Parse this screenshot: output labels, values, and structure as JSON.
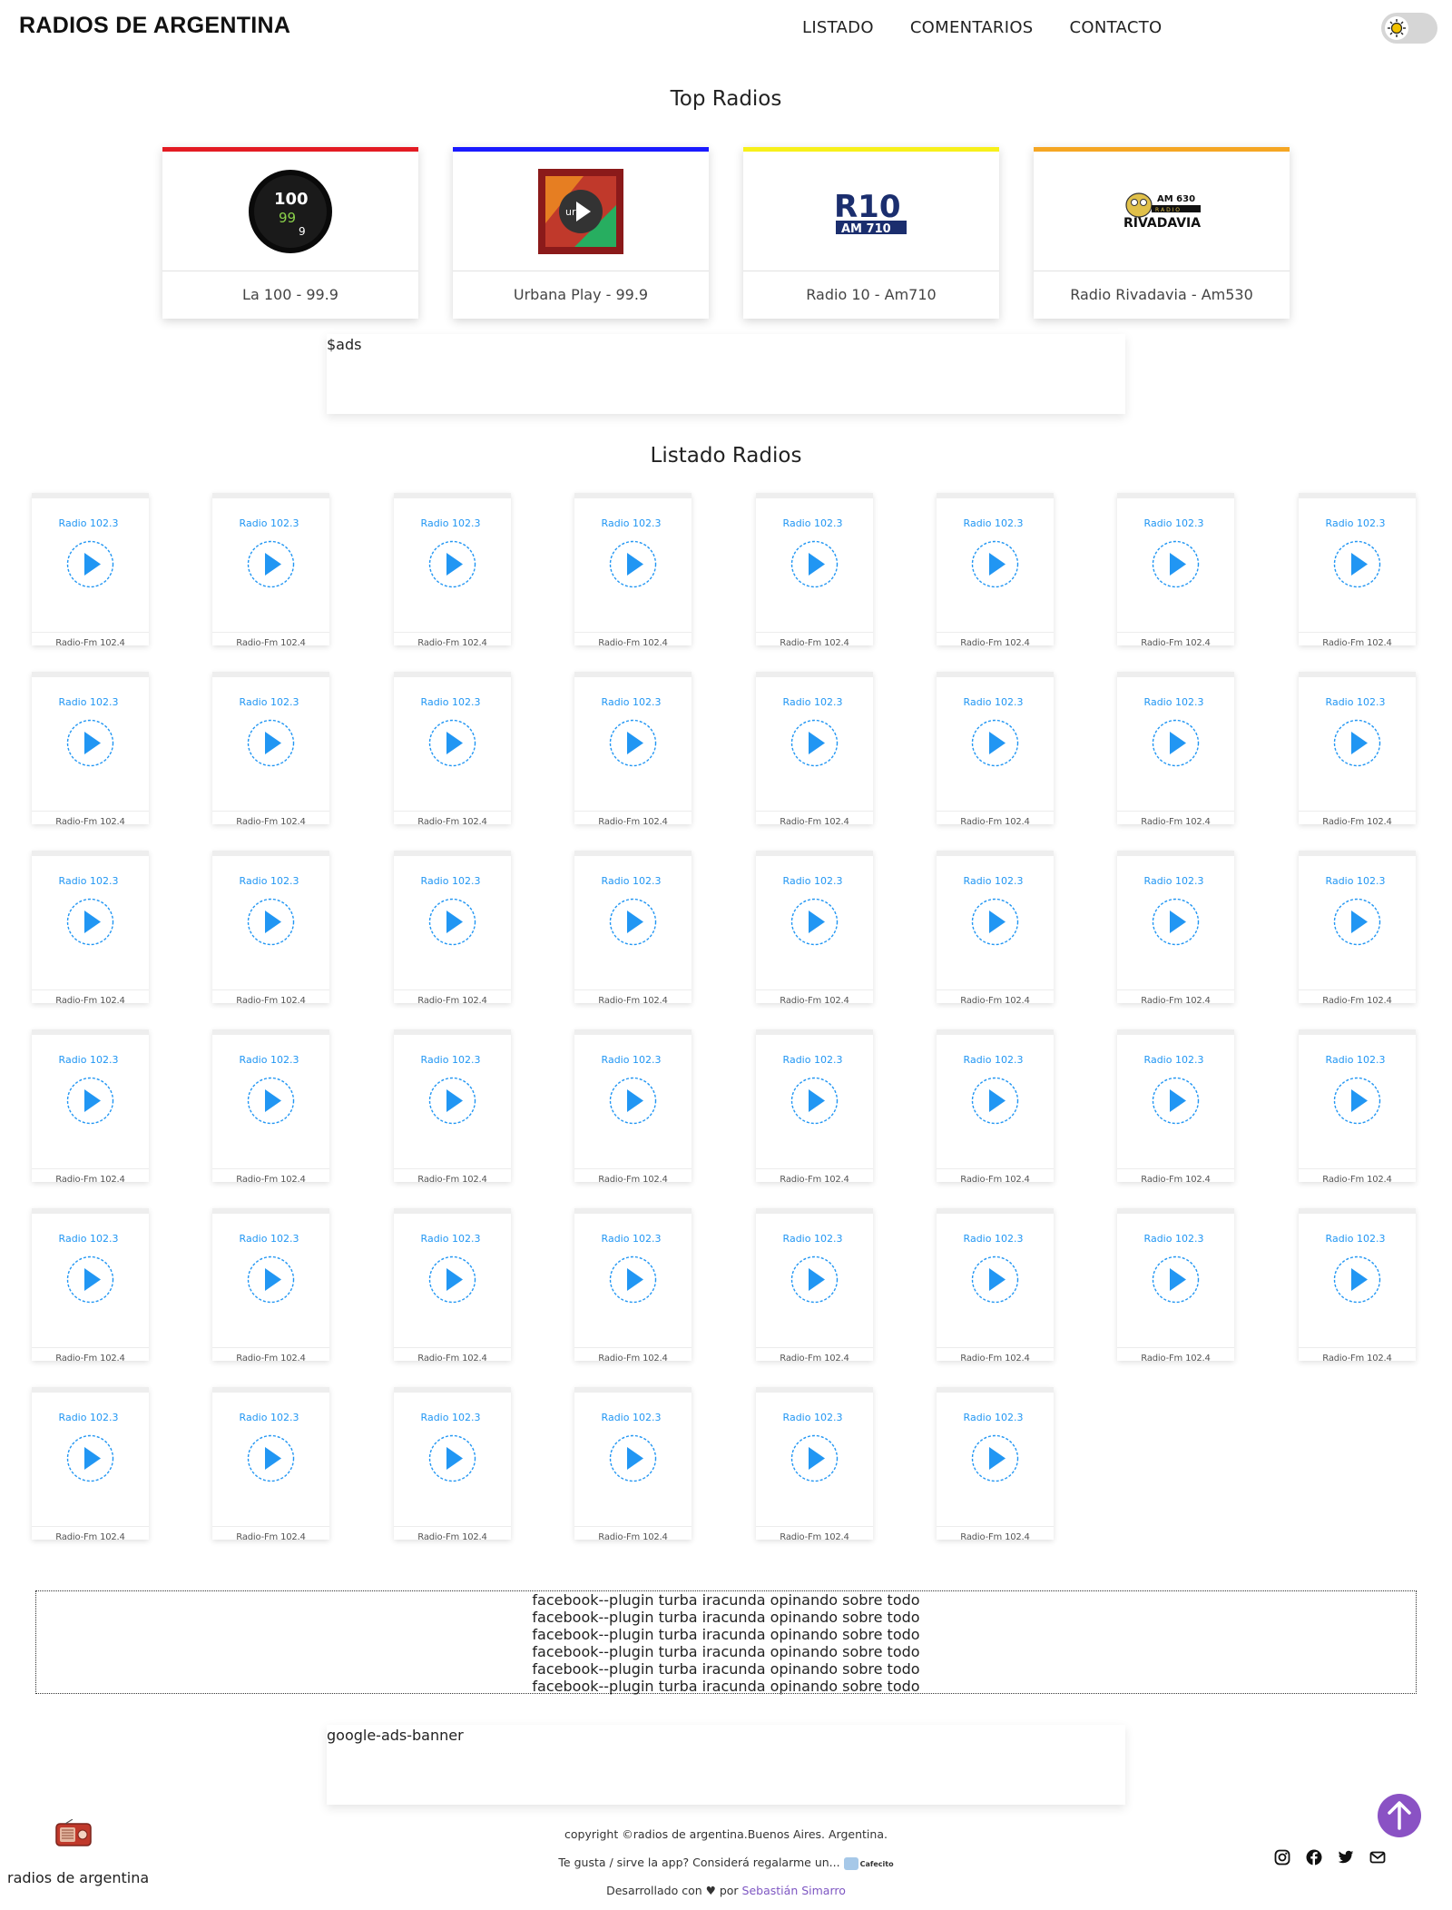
{
  "header": {
    "brand": "RADIOS DE ARGENTINA",
    "nav": [
      "LISTADO",
      "COMENTARIOS",
      "CONTACTO"
    ],
    "theme_toggle_icon": "sun-icon"
  },
  "top_section": {
    "title": "Top Radios",
    "cards": [
      {
        "name": "La 100 - 99.9",
        "accent": "#e31b23",
        "logo_icon": "la100-logo"
      },
      {
        "name": "Urbana Play - 99.9",
        "accent": "#1a1aff",
        "logo_icon": "urbana-play-logo"
      },
      {
        "name": "Radio 10 - Am710",
        "accent": "#f7f01a",
        "logo_icon": "radio10-logo"
      },
      {
        "name": "Radio Rivadavia - Am530",
        "accent": "#f5a623",
        "logo_icon": "rivadavia-logo"
      }
    ],
    "logo_text": {
      "la100_a": "100",
      "la100_b": "99",
      "la100_c": "9",
      "urbana": "urb",
      "radio10_top": "R10",
      "radio10_bottom": "AM 710",
      "riv_am": "AM 630",
      "riv_radio": "R A D I O",
      "riv_name": "RIVADAVIA"
    }
  },
  "ads_top": "$ads",
  "list_section": {
    "title": "Listado Radios",
    "play_icon": "play-circle-icon",
    "cards": [
      {
        "title": "Radio 102.3",
        "footer": "Radio-Fm 102.4"
      },
      {
        "title": "Radio 102.3",
        "footer": "Radio-Fm 102.4"
      },
      {
        "title": "Radio 102.3",
        "footer": "Radio-Fm 102.4"
      },
      {
        "title": "Radio 102.3",
        "footer": "Radio-Fm 102.4"
      },
      {
        "title": "Radio 102.3",
        "footer": "Radio-Fm 102.4"
      },
      {
        "title": "Radio 102.3",
        "footer": "Radio-Fm 102.4"
      },
      {
        "title": "Radio 102.3",
        "footer": "Radio-Fm 102.4"
      },
      {
        "title": "Radio 102.3",
        "footer": "Radio-Fm 102.4"
      },
      {
        "title": "Radio 102.3",
        "footer": "Radio-Fm 102.4"
      },
      {
        "title": "Radio 102.3",
        "footer": "Radio-Fm 102.4"
      },
      {
        "title": "Radio 102.3",
        "footer": "Radio-Fm 102.4"
      },
      {
        "title": "Radio 102.3",
        "footer": "Radio-Fm 102.4"
      },
      {
        "title": "Radio 102.3",
        "footer": "Radio-Fm 102.4"
      },
      {
        "title": "Radio 102.3",
        "footer": "Radio-Fm 102.4"
      },
      {
        "title": "Radio 102.3",
        "footer": "Radio-Fm 102.4"
      },
      {
        "title": "Radio 102.3",
        "footer": "Radio-Fm 102.4"
      },
      {
        "title": "Radio 102.3",
        "footer": "Radio-Fm 102.4"
      },
      {
        "title": "Radio 102.3",
        "footer": "Radio-Fm 102.4"
      },
      {
        "title": "Radio 102.3",
        "footer": "Radio-Fm 102.4"
      },
      {
        "title": "Radio 102.3",
        "footer": "Radio-Fm 102.4"
      },
      {
        "title": "Radio 102.3",
        "footer": "Radio-Fm 102.4"
      },
      {
        "title": "Radio 102.3",
        "footer": "Radio-Fm 102.4"
      },
      {
        "title": "Radio 102.3",
        "footer": "Radio-Fm 102.4"
      },
      {
        "title": "Radio 102.3",
        "footer": "Radio-Fm 102.4"
      },
      {
        "title": "Radio 102.3",
        "footer": "Radio-Fm 102.4"
      },
      {
        "title": "Radio 102.3",
        "footer": "Radio-Fm 102.4"
      },
      {
        "title": "Radio 102.3",
        "footer": "Radio-Fm 102.4"
      },
      {
        "title": "Radio 102.3",
        "footer": "Radio-Fm 102.4"
      },
      {
        "title": "Radio 102.3",
        "footer": "Radio-Fm 102.4"
      },
      {
        "title": "Radio 102.3",
        "footer": "Radio-Fm 102.4"
      },
      {
        "title": "Radio 102.3",
        "footer": "Radio-Fm 102.4"
      },
      {
        "title": "Radio 102.3",
        "footer": "Radio-Fm 102.4"
      },
      {
        "title": "Radio 102.3",
        "footer": "Radio-Fm 102.4"
      },
      {
        "title": "Radio 102.3",
        "footer": "Radio-Fm 102.4"
      },
      {
        "title": "Radio 102.3",
        "footer": "Radio-Fm 102.4"
      },
      {
        "title": "Radio 102.3",
        "footer": "Radio-Fm 102.4"
      },
      {
        "title": "Radio 102.3",
        "footer": "Radio-Fm 102.4"
      },
      {
        "title": "Radio 102.3",
        "footer": "Radio-Fm 102.4"
      },
      {
        "title": "Radio 102.3",
        "footer": "Radio-Fm 102.4"
      },
      {
        "title": "Radio 102.3",
        "footer": "Radio-Fm 102.4"
      },
      {
        "title": "Radio 102.3",
        "footer": "Radio-Fm 102.4"
      },
      {
        "title": "Radio 102.3",
        "footer": "Radio-Fm 102.4"
      },
      {
        "title": "Radio 102.3",
        "footer": "Radio-Fm 102.4"
      },
      {
        "title": "Radio 102.3",
        "footer": "Radio-Fm 102.4"
      },
      {
        "title": "Radio 102.3",
        "footer": "Radio-Fm 102.4"
      },
      {
        "title": "Radio 102.3",
        "footer": "Radio-Fm 102.4"
      }
    ]
  },
  "facebook_plugin": {
    "lines": [
      "facebook--plugin turba iracunda opinando sobre todo",
      "facebook--plugin turba iracunda opinando sobre todo",
      "facebook--plugin turba iracunda opinando sobre todo",
      "facebook--plugin turba iracunda opinando sobre todo",
      "facebook--plugin turba iracunda opinando sobre todo",
      "facebook--plugin turba iracunda opinando sobre todo"
    ]
  },
  "ads_bottom": "google-ads-banner",
  "footer": {
    "brand": "radios de argentina",
    "logo_icon": "vintage-radio-icon",
    "copyright": "copyright ©radios de argentina.Buenos Aires. Argentina.",
    "donate_text": "Te gusta / sirve la app? Considerá regalarme un...",
    "cafecito_label": "Cafecito",
    "dev_prefix": "Desarrollado con",
    "dev_by": "por",
    "dev_name": "Sebastián Simarro",
    "heart_icon": "heart-icon",
    "scroll_top_icon": "arrow-up-icon",
    "social_icons": [
      "instagram-icon",
      "facebook-icon",
      "twitter-icon",
      "email-icon"
    ],
    "accent": "#8a52c4"
  }
}
